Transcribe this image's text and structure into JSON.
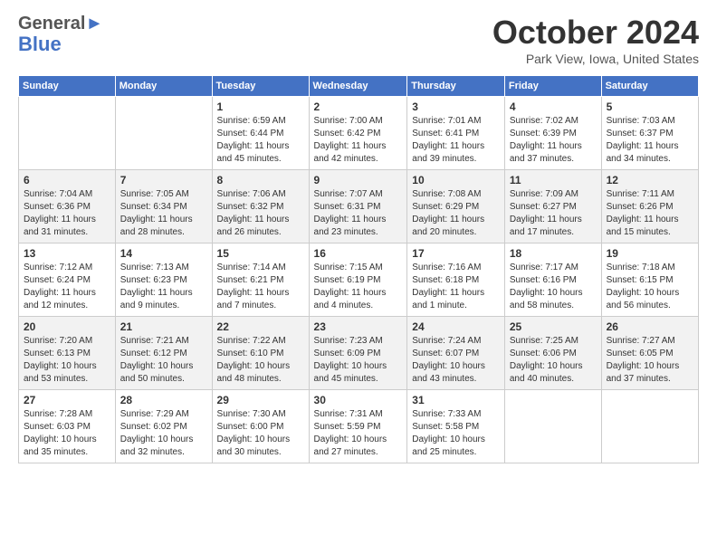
{
  "header": {
    "logo_line1": "General",
    "logo_line2": "Blue",
    "main_title": "October 2024",
    "subtitle": "Park View, Iowa, United States"
  },
  "days_of_week": [
    "Sunday",
    "Monday",
    "Tuesday",
    "Wednesday",
    "Thursday",
    "Friday",
    "Saturday"
  ],
  "weeks": [
    [
      {
        "day": "",
        "info": ""
      },
      {
        "day": "",
        "info": ""
      },
      {
        "day": "1",
        "info": "Sunrise: 6:59 AM\nSunset: 6:44 PM\nDaylight: 11 hours and 45 minutes."
      },
      {
        "day": "2",
        "info": "Sunrise: 7:00 AM\nSunset: 6:42 PM\nDaylight: 11 hours and 42 minutes."
      },
      {
        "day": "3",
        "info": "Sunrise: 7:01 AM\nSunset: 6:41 PM\nDaylight: 11 hours and 39 minutes."
      },
      {
        "day": "4",
        "info": "Sunrise: 7:02 AM\nSunset: 6:39 PM\nDaylight: 11 hours and 37 minutes."
      },
      {
        "day": "5",
        "info": "Sunrise: 7:03 AM\nSunset: 6:37 PM\nDaylight: 11 hours and 34 minutes."
      }
    ],
    [
      {
        "day": "6",
        "info": "Sunrise: 7:04 AM\nSunset: 6:36 PM\nDaylight: 11 hours and 31 minutes."
      },
      {
        "day": "7",
        "info": "Sunrise: 7:05 AM\nSunset: 6:34 PM\nDaylight: 11 hours and 28 minutes."
      },
      {
        "day": "8",
        "info": "Sunrise: 7:06 AM\nSunset: 6:32 PM\nDaylight: 11 hours and 26 minutes."
      },
      {
        "day": "9",
        "info": "Sunrise: 7:07 AM\nSunset: 6:31 PM\nDaylight: 11 hours and 23 minutes."
      },
      {
        "day": "10",
        "info": "Sunrise: 7:08 AM\nSunset: 6:29 PM\nDaylight: 11 hours and 20 minutes."
      },
      {
        "day": "11",
        "info": "Sunrise: 7:09 AM\nSunset: 6:27 PM\nDaylight: 11 hours and 17 minutes."
      },
      {
        "day": "12",
        "info": "Sunrise: 7:11 AM\nSunset: 6:26 PM\nDaylight: 11 hours and 15 minutes."
      }
    ],
    [
      {
        "day": "13",
        "info": "Sunrise: 7:12 AM\nSunset: 6:24 PM\nDaylight: 11 hours and 12 minutes."
      },
      {
        "day": "14",
        "info": "Sunrise: 7:13 AM\nSunset: 6:23 PM\nDaylight: 11 hours and 9 minutes."
      },
      {
        "day": "15",
        "info": "Sunrise: 7:14 AM\nSunset: 6:21 PM\nDaylight: 11 hours and 7 minutes."
      },
      {
        "day": "16",
        "info": "Sunrise: 7:15 AM\nSunset: 6:19 PM\nDaylight: 11 hours and 4 minutes."
      },
      {
        "day": "17",
        "info": "Sunrise: 7:16 AM\nSunset: 6:18 PM\nDaylight: 11 hours and 1 minute."
      },
      {
        "day": "18",
        "info": "Sunrise: 7:17 AM\nSunset: 6:16 PM\nDaylight: 10 hours and 58 minutes."
      },
      {
        "day": "19",
        "info": "Sunrise: 7:18 AM\nSunset: 6:15 PM\nDaylight: 10 hours and 56 minutes."
      }
    ],
    [
      {
        "day": "20",
        "info": "Sunrise: 7:20 AM\nSunset: 6:13 PM\nDaylight: 10 hours and 53 minutes."
      },
      {
        "day": "21",
        "info": "Sunrise: 7:21 AM\nSunset: 6:12 PM\nDaylight: 10 hours and 50 minutes."
      },
      {
        "day": "22",
        "info": "Sunrise: 7:22 AM\nSunset: 6:10 PM\nDaylight: 10 hours and 48 minutes."
      },
      {
        "day": "23",
        "info": "Sunrise: 7:23 AM\nSunset: 6:09 PM\nDaylight: 10 hours and 45 minutes."
      },
      {
        "day": "24",
        "info": "Sunrise: 7:24 AM\nSunset: 6:07 PM\nDaylight: 10 hours and 43 minutes."
      },
      {
        "day": "25",
        "info": "Sunrise: 7:25 AM\nSunset: 6:06 PM\nDaylight: 10 hours and 40 minutes."
      },
      {
        "day": "26",
        "info": "Sunrise: 7:27 AM\nSunset: 6:05 PM\nDaylight: 10 hours and 37 minutes."
      }
    ],
    [
      {
        "day": "27",
        "info": "Sunrise: 7:28 AM\nSunset: 6:03 PM\nDaylight: 10 hours and 35 minutes."
      },
      {
        "day": "28",
        "info": "Sunrise: 7:29 AM\nSunset: 6:02 PM\nDaylight: 10 hours and 32 minutes."
      },
      {
        "day": "29",
        "info": "Sunrise: 7:30 AM\nSunset: 6:00 PM\nDaylight: 10 hours and 30 minutes."
      },
      {
        "day": "30",
        "info": "Sunrise: 7:31 AM\nSunset: 5:59 PM\nDaylight: 10 hours and 27 minutes."
      },
      {
        "day": "31",
        "info": "Sunrise: 7:33 AM\nSunset: 5:58 PM\nDaylight: 10 hours and 25 minutes."
      },
      {
        "day": "",
        "info": ""
      },
      {
        "day": "",
        "info": ""
      }
    ]
  ]
}
